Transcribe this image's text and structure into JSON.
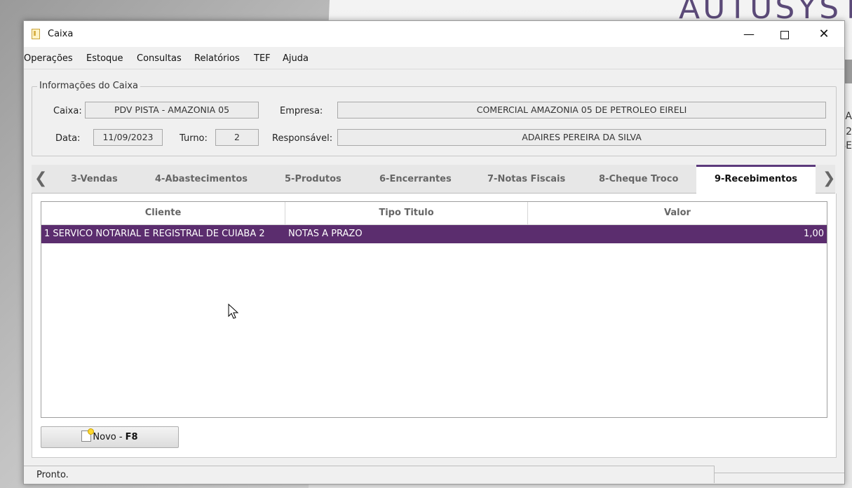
{
  "background": {
    "brand": "AUTUSYST",
    "side_texts": [
      "IA",
      "2",
      "SE"
    ]
  },
  "window": {
    "title": "Caixa",
    "controls": {
      "minimize": "—",
      "close": "✕"
    }
  },
  "menu": [
    "Operações",
    "Estoque",
    "Consultas",
    "Relatórios",
    "TEF",
    "Ajuda"
  ],
  "info": {
    "legend": "Informações do Caixa",
    "caixa_label": "Caixa:",
    "caixa_value": "PDV PISTA - AMAZONIA 05",
    "empresa_label": "Empresa:",
    "empresa_value": "COMERCIAL AMAZONIA 05 DE PETROLEO EIRELI",
    "data_label": "Data:",
    "data_value": "11/09/2023",
    "turno_label": "Turno:",
    "turno_value": "2",
    "responsavel_label": "Responsável:",
    "responsavel_value": "ADAIRES PEREIRA DA SILVA"
  },
  "tabs": {
    "prev_arrow": "❮",
    "next_arrow": "❯",
    "items": [
      "3-Vendas",
      "4-Abastecimentos",
      "5-Produtos",
      "6-Encerrantes",
      "7-Notas Fiscais",
      "8-Cheque Troco",
      "9-Recebimentos"
    ],
    "active": "9-Recebimentos"
  },
  "grid": {
    "columns": [
      "Cliente",
      "Tipo Titulo",
      "Valor"
    ],
    "rows": [
      {
        "cliente": "1 SERVICO NOTARIAL E REGISTRAL DE CUIABA 2",
        "tipo": "NOTAS A PRAZO",
        "valor": "1,00"
      }
    ],
    "selected_color": "#5b2d6e"
  },
  "buttons": {
    "novo_label": "Novo - ",
    "novo_key": "F8"
  },
  "status": {
    "text": "Pronto."
  }
}
